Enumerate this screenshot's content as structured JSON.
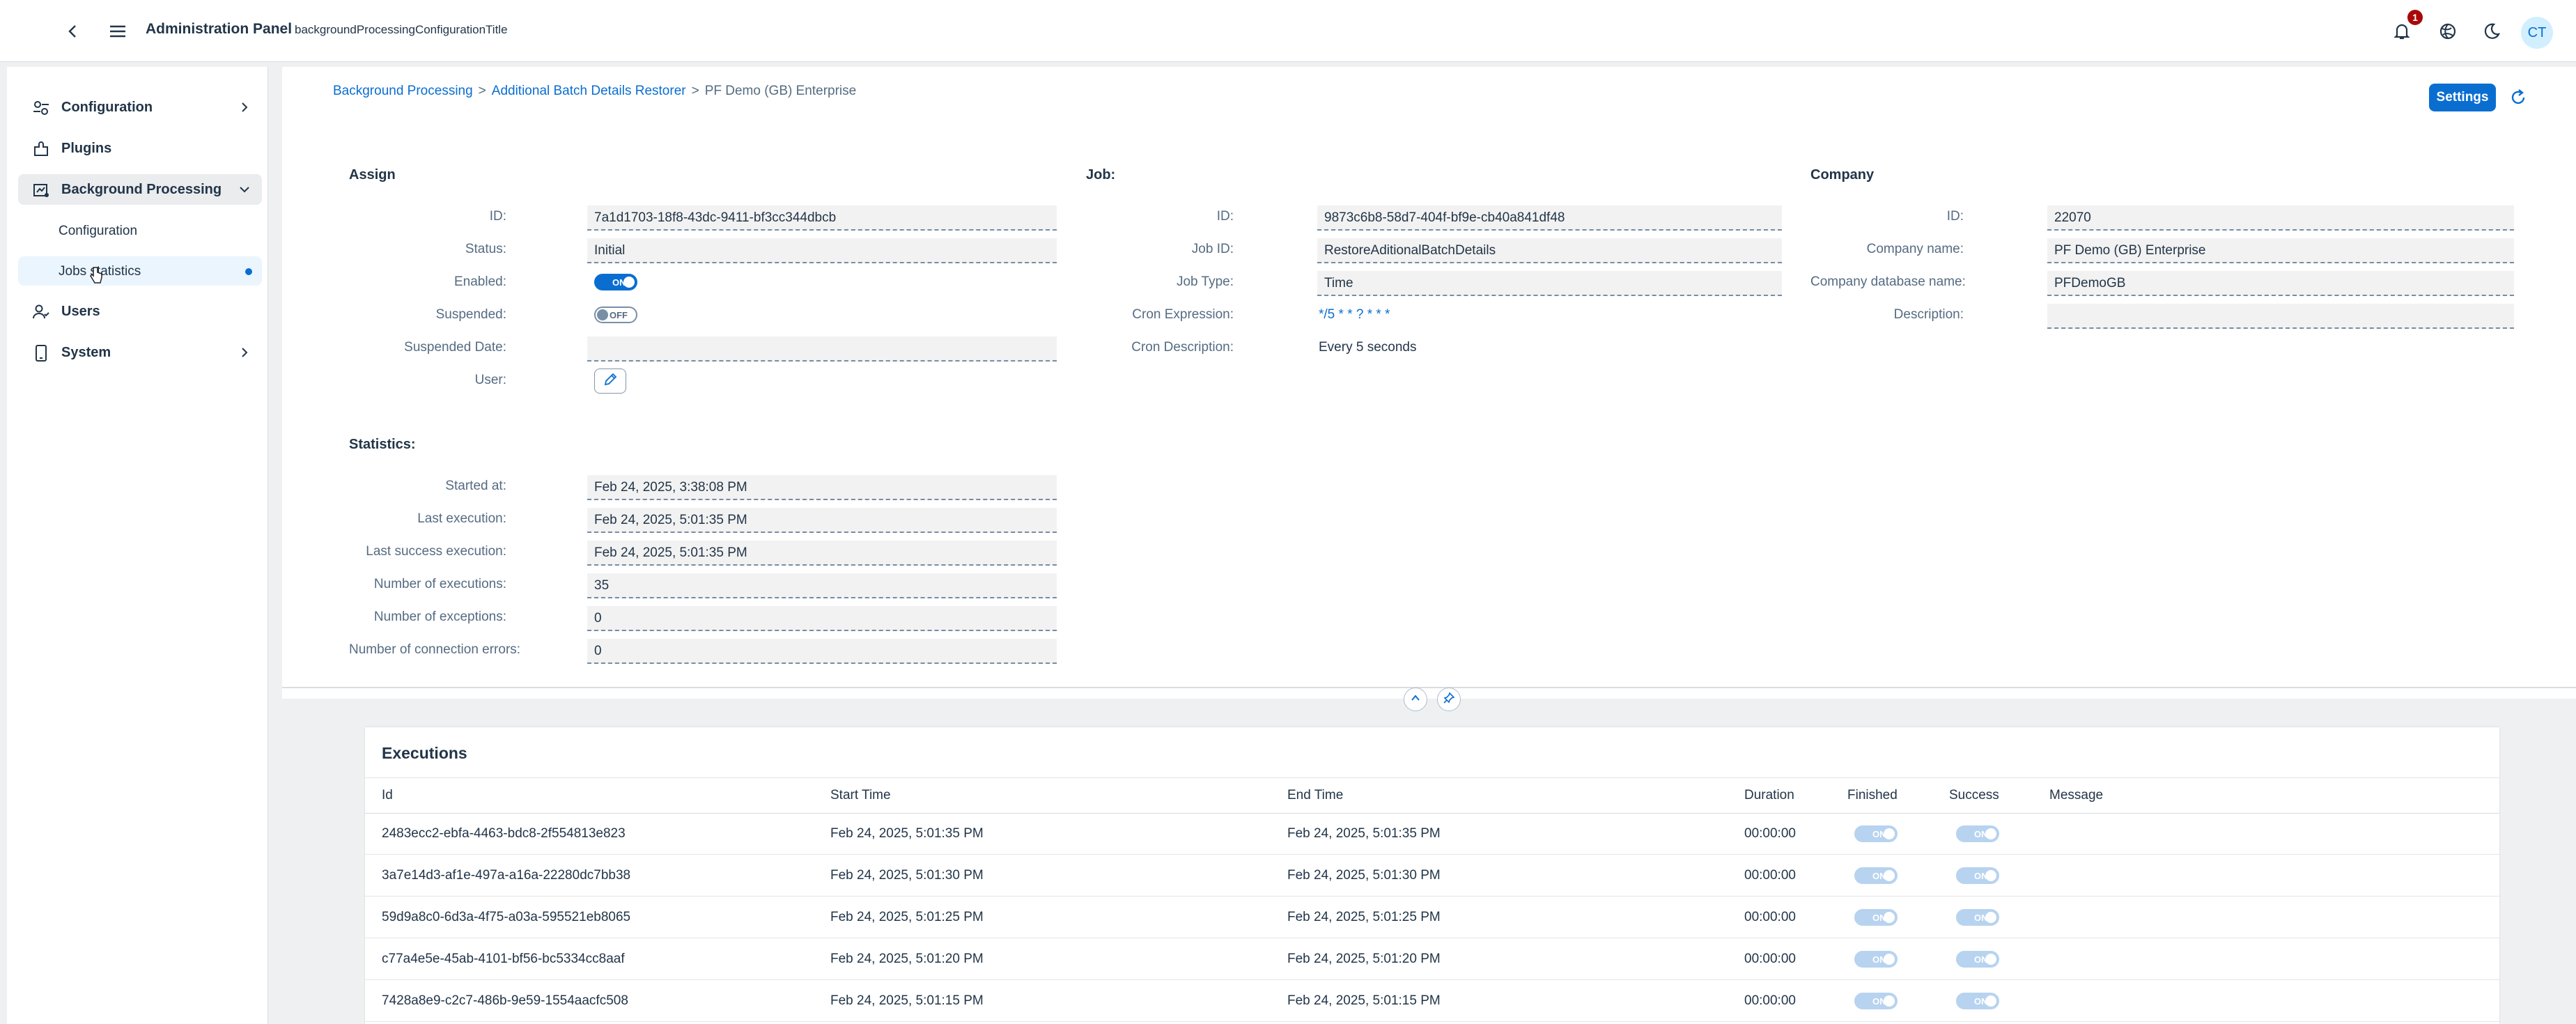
{
  "header": {
    "title": "Administration Panel",
    "subtitle": "backgroundProcessingConfigurationTitle",
    "notification_count": "1",
    "avatar_initials": "CT"
  },
  "sidebar": {
    "items": [
      {
        "label": "Configuration",
        "icon": "configuration-icon"
      },
      {
        "label": "Plugins",
        "icon": "plugin-icon"
      },
      {
        "label": "Background Processing",
        "icon": "background-processing-icon"
      },
      {
        "label": "Users",
        "icon": "users-icon"
      },
      {
        "label": "System",
        "icon": "system-icon"
      }
    ],
    "subitems": [
      {
        "label": "Configuration"
      },
      {
        "label": "Jobs statistics"
      }
    ]
  },
  "breadcrumb": {
    "link1": "Background Processing",
    "sep": ">",
    "link2": "Additional Batch Details Restorer",
    "current": "PF Demo (GB) Enterprise"
  },
  "toolbar": {
    "settings_label": "Settings"
  },
  "assign": {
    "title": "Assign",
    "id_label": "ID:",
    "id": "7a1d1703-18f8-43dc-9411-bf3cc344dbcb",
    "status_label": "Status:",
    "status": "Initial",
    "enabled_label": "Enabled:",
    "enabled": "ON",
    "suspended_label": "Suspended:",
    "suspended": "OFF",
    "suspended_date_label": "Suspended Date:",
    "suspended_date": "",
    "user_label": "User:"
  },
  "job": {
    "title": "Job:",
    "id_label": "ID:",
    "id": "9873c6b8-58d7-404f-bf9e-cb40a841df48",
    "job_id_label": "Job ID:",
    "job_id": "RestoreAditionalBatchDetails",
    "job_type_label": "Job Type:",
    "job_type": "Time",
    "cron_expression_label": "Cron Expression:",
    "cron_expression": "*/5 * * ? * * *",
    "cron_description_label": "Cron Description:",
    "cron_description": "Every 5 seconds"
  },
  "company": {
    "title": "Company",
    "id_label": "ID:",
    "id": "22070",
    "name_label": "Company name:",
    "name": "PF Demo (GB) Enterprise",
    "db_label": "Company database name:",
    "db": "PFDemoGB",
    "description_label": "Description:",
    "description": ""
  },
  "statistics": {
    "title": "Statistics:",
    "fields": [
      {
        "label": "Started at:",
        "value": "Feb 24, 2025, 3:38:08 PM"
      },
      {
        "label": "Last execution:",
        "value": "Feb 24, 2025, 5:01:35 PM"
      },
      {
        "label": "Last success execution:",
        "value": "Feb 24, 2025, 5:01:35 PM"
      },
      {
        "label": "Number of executions:",
        "value": "35"
      },
      {
        "label": "Number of exceptions:",
        "value": "0"
      },
      {
        "label": "Number of connection errors:",
        "value": "0"
      }
    ]
  },
  "executions": {
    "title": "Executions",
    "columns": [
      "Id",
      "Start Time",
      "End Time",
      "Duration",
      "Finished",
      "Success",
      "Message"
    ],
    "rows": [
      {
        "id": "2483ecc2-ebfa-4463-bdc8-2f554813e823",
        "start": "Feb 24, 2025, 5:01:35 PM",
        "end": "Feb 24, 2025, 5:01:35 PM",
        "duration": "00:00:00",
        "finished": "ON",
        "success": "ON",
        "message": ""
      },
      {
        "id": "3a7e14d3-af1e-497a-a16a-22280dc7bb38",
        "start": "Feb 24, 2025, 5:01:30 PM",
        "end": "Feb 24, 2025, 5:01:30 PM",
        "duration": "00:00:00",
        "finished": "ON",
        "success": "ON",
        "message": ""
      },
      {
        "id": "59d9a8c0-6d3a-4f75-a03a-595521eb8065",
        "start": "Feb 24, 2025, 5:01:25 PM",
        "end": "Feb 24, 2025, 5:01:25 PM",
        "duration": "00:00:00",
        "finished": "ON",
        "success": "ON",
        "message": ""
      },
      {
        "id": "c77a4e5e-45ab-4101-bf56-bc5334cc8aaf",
        "start": "Feb 24, 2025, 5:01:20 PM",
        "end": "Feb 24, 2025, 5:01:20 PM",
        "duration": "00:00:00",
        "finished": "ON",
        "success": "ON",
        "message": ""
      },
      {
        "id": "7428a8e9-c2c7-486b-9e59-1554aacfc508",
        "start": "Feb 24, 2025, 5:01:15 PM",
        "end": "Feb 24, 2025, 5:01:15 PM",
        "duration": "00:00:00",
        "finished": "ON",
        "success": "ON",
        "message": ""
      }
    ]
  },
  "colors": {
    "accent": "#0a6ed1",
    "text": "#223548",
    "label": "#556b82",
    "badge": "#aa0808"
  }
}
